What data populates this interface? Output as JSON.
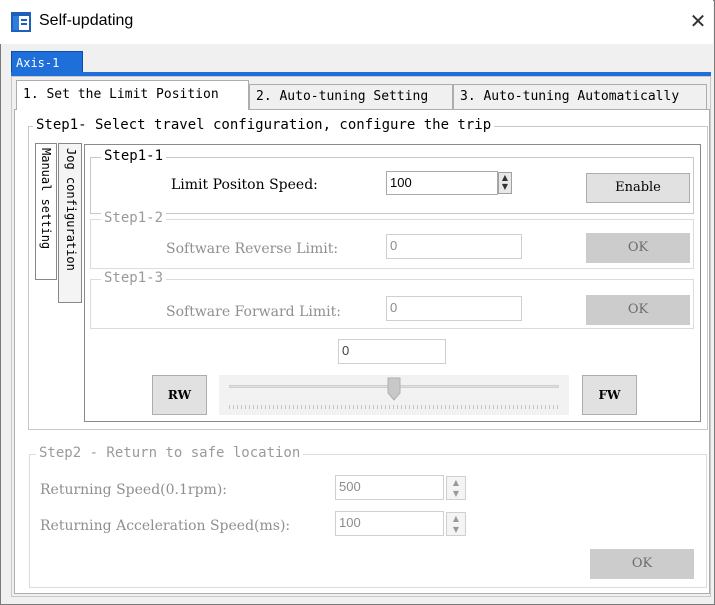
{
  "window": {
    "title": "Self-updating",
    "close_glyph": "✕"
  },
  "axis_tab": {
    "label": "Axis-1"
  },
  "tabs": [
    {
      "label": "1. Set the Limit Position"
    },
    {
      "label": "2. Auto-tuning Setting"
    },
    {
      "label": "3. Auto-tuning Automatically"
    }
  ],
  "step1": {
    "legend": "Step1- Select travel configuration, configure the trip",
    "side_tabs": [
      {
        "label": "Manual setting"
      },
      {
        "label": "Jog configuration"
      }
    ],
    "step1_1": {
      "legend": "Step1-1",
      "label": "Limit Positon Speed:",
      "value": "100",
      "button": "Enable"
    },
    "step1_2": {
      "legend": "Step1-2",
      "label": "Software Reverse Limit:",
      "value": "0",
      "button": "OK"
    },
    "step1_3": {
      "legend": "Step1-3",
      "label": "Software Forward Limit:",
      "value": "0",
      "button": "OK"
    },
    "jog": {
      "position_value": "0",
      "rw_button": "RW",
      "fw_button": "FW",
      "slider_level": 0.5
    }
  },
  "step2": {
    "legend": "Step2 - Return to safe location",
    "returning_speed_label": "Returning Speed(0.1rpm):",
    "returning_speed_value": "500",
    "returning_accel_label": "Returning Acceleration Speed(ms):",
    "returning_accel_value": "100",
    "ok_button": "OK"
  },
  "colors": {
    "accent": "#1e6fd9",
    "disabled_button": "#cccccc"
  },
  "icons": {
    "app": "app-window-icon",
    "spin": "spin-arrows-icon"
  }
}
